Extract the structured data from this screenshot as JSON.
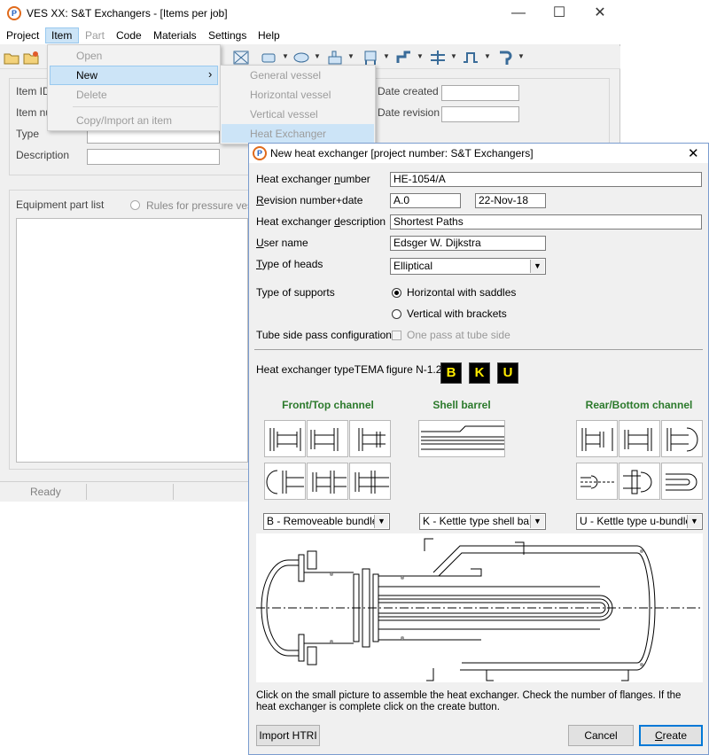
{
  "window": {
    "title": "VES XX: S&T Exchangers - [Items per job]",
    "controls": {
      "minimize": "—",
      "maximize": "☐",
      "close": "✕"
    }
  },
  "menubar": {
    "items": [
      {
        "label": "Project"
      },
      {
        "label": "Item"
      },
      {
        "label": "Part"
      },
      {
        "label": "Code"
      },
      {
        "label": "Materials"
      },
      {
        "label": "Settings"
      },
      {
        "label": "Help"
      }
    ]
  },
  "item_menu": {
    "items": [
      {
        "label": "Open"
      },
      {
        "label": "New",
        "arrow": "›"
      },
      {
        "label": "Delete"
      },
      {
        "label": "Copy/Import an item"
      }
    ]
  },
  "new_submenu": {
    "items": [
      {
        "label": "General vessel"
      },
      {
        "label": "Horizontal vessel"
      },
      {
        "label": "Vertical vessel"
      },
      {
        "label": "Heat Exchanger"
      }
    ]
  },
  "main_form": {
    "item_id_label": "Item ID",
    "item_number_label": "Item nu",
    "type_label": "Type",
    "description_label": "Description",
    "date_created_label": "Date created",
    "date_revision_label": "Date revision",
    "equipment_list_label": "Equipment part list",
    "rules_label": "Rules for pressure vesse"
  },
  "statusbar": {
    "status": "Ready"
  },
  "dialog": {
    "title": "New heat exchanger [project number: S&T Exchangers]",
    "close": "✕",
    "labels": {
      "hx_number": "Heat exchanger number",
      "revision": "Revision number+date",
      "description": "Heat exchanger description",
      "user_name": "User name",
      "heads": "Type of heads",
      "supports": "Type of supports",
      "tube_side": "Tube side pass configuration"
    },
    "values": {
      "hx_number": "HE-1054/A",
      "revision_number": "A.0",
      "revision_date": "22-Nov-18",
      "description": "Shortest Paths",
      "user_name": "Edsger W. Dijkstra",
      "heads": "Elliptical"
    },
    "supports_options": [
      {
        "label": "Horizontal with saddles",
        "selected": true
      },
      {
        "label": "Vertical with brackets",
        "selected": false
      }
    ],
    "tube_side_option": "One pass at tube side",
    "tema_label": "Heat exchanger typeTEMA figure N-1.2",
    "tema_letters": [
      "B",
      "K",
      "U"
    ],
    "sections": {
      "front": "Front/Top channel",
      "shell": "Shell barrel",
      "rear": "Rear/Bottom channel"
    },
    "selects": {
      "front": "B - Removeable bundle",
      "shell": "K - Kettle type shell barrel",
      "rear": "U - Kettle type u-bundle"
    },
    "help_text": "Click on the small picture to assemble the heat exchanger. Check the number of flanges. If the heat exchanger is complete click on the create button.",
    "buttons": {
      "import": "Import HTRI",
      "cancel": "Cancel",
      "create": "Create"
    }
  },
  "colors": {
    "highlight": "#cce4f7",
    "section_header": "#2c7a2c",
    "tema_text": "#ffeb00"
  }
}
